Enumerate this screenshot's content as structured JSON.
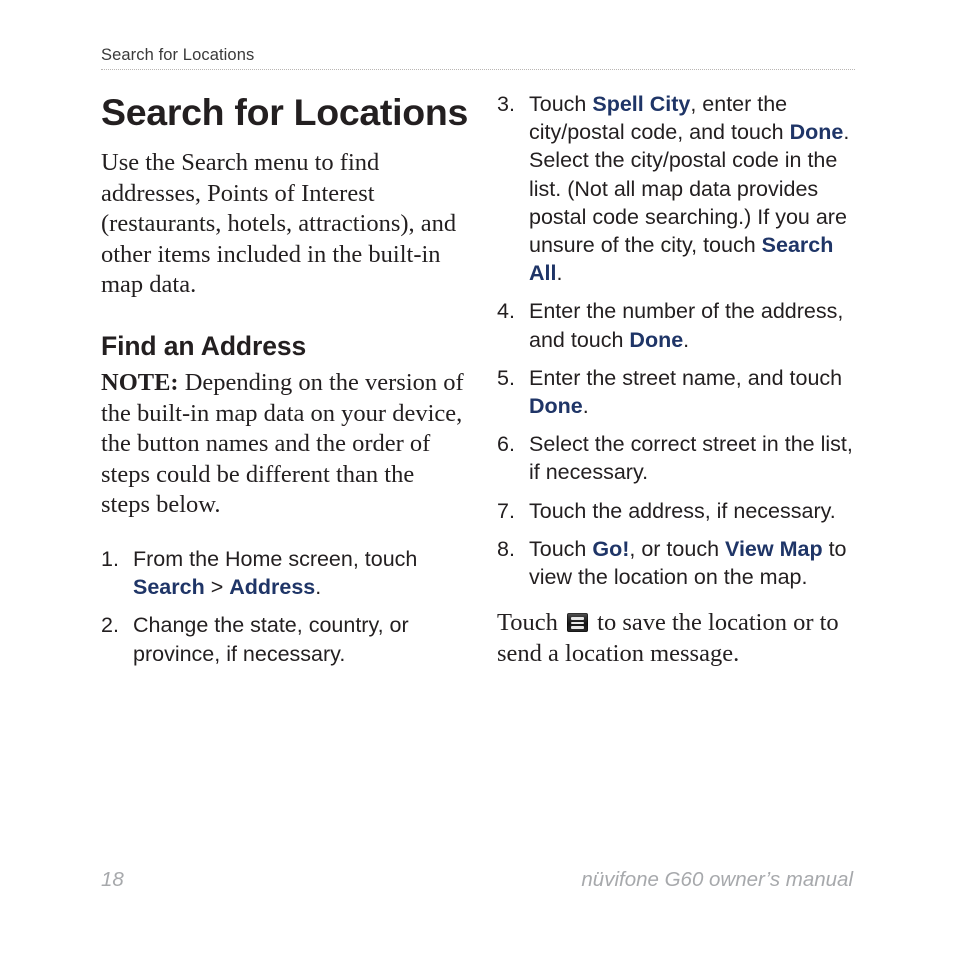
{
  "header": {
    "running_title": "Search for Locations"
  },
  "title": "Search for Locations",
  "intro": "Use the Search menu to find addresses, Points of Interest (restaurants, hotels, attractions), and other items included in the built-in map data.",
  "section": {
    "heading": "Find an Address",
    "note_label": "NOTE:",
    "note_text": " Depending on the version of the built-in map data on your device, the button names and the order of steps could be different than the steps below."
  },
  "steps_left": [
    {
      "num": "1.",
      "parts": [
        {
          "t": "From the Home screen, touch ",
          "ui": false
        },
        {
          "t": "Search",
          "ui": true
        },
        {
          "t": " > ",
          "ui": false
        },
        {
          "t": "Address",
          "ui": true
        },
        {
          "t": ".",
          "ui": false
        }
      ]
    },
    {
      "num": "2.",
      "parts": [
        {
          "t": "Change the state, country, or province, if necessary.",
          "ui": false
        }
      ]
    }
  ],
  "steps_right": [
    {
      "num": "3.",
      "parts": [
        {
          "t": "Touch ",
          "ui": false
        },
        {
          "t": "Spell City",
          "ui": true
        },
        {
          "t": ", enter the city/postal code, and touch ",
          "ui": false
        },
        {
          "t": "Done",
          "ui": true
        },
        {
          "t": ". Select the city/postal code in the list. (Not all map data provides postal code searching.) If you are unsure of the city, touch ",
          "ui": false
        },
        {
          "t": "Search All",
          "ui": true
        },
        {
          "t": ".",
          "ui": false
        }
      ]
    },
    {
      "num": "4.",
      "parts": [
        {
          "t": "Enter the number of the address, and touch ",
          "ui": false
        },
        {
          "t": "Done",
          "ui": true
        },
        {
          "t": ".",
          "ui": false
        }
      ]
    },
    {
      "num": "5.",
      "parts": [
        {
          "t": "Enter the street name, and touch ",
          "ui": false
        },
        {
          "t": "Done",
          "ui": true
        },
        {
          "t": ".",
          "ui": false
        }
      ]
    },
    {
      "num": "6.",
      "parts": [
        {
          "t": "Select the correct street in the list, if necessary.",
          "ui": false
        }
      ]
    },
    {
      "num": "7.",
      "parts": [
        {
          "t": "Touch the address, if necessary.",
          "ui": false
        }
      ]
    },
    {
      "num": "8.",
      "parts": [
        {
          "t": "Touch ",
          "ui": false
        },
        {
          "t": "Go!",
          "ui": true
        },
        {
          "t": ", or touch ",
          "ui": false
        },
        {
          "t": "View Map",
          "ui": true
        },
        {
          "t": " to view the location on the map.",
          "ui": false
        }
      ]
    }
  ],
  "closing": {
    "before_icon": "Touch ",
    "icon": "menu-icon",
    "after_icon": " to save the location or to send a location message."
  },
  "footer": {
    "page_number": "18",
    "manual_title": "nüvifone G60 owner’s manual"
  },
  "colors": {
    "ui_term_blue": "#1f3567",
    "body_text": "#231f20",
    "footer_gray": "#a7a9ac",
    "rule_gray": "#b9b6b4"
  }
}
